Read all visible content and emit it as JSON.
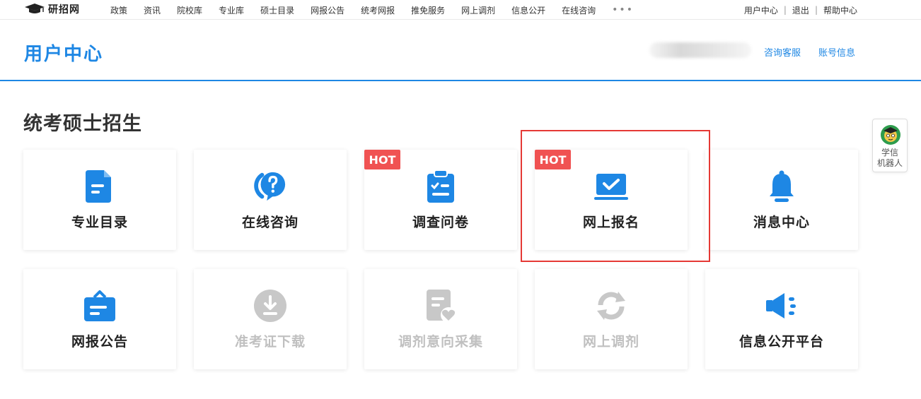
{
  "logo": {
    "text": "研招网"
  },
  "nav": {
    "items": [
      "政策",
      "资讯",
      "院校库",
      "专业库",
      "硕士目录",
      "网报公告",
      "统考网报",
      "推免服务",
      "网上调剂",
      "信息公开",
      "在线咨询"
    ],
    "more": "•••"
  },
  "toplinks": {
    "user_center": "用户中心",
    "logout": "退出",
    "help": "帮助中心",
    "sep": "|"
  },
  "header": {
    "title": "用户中心",
    "consult": "咨询客服",
    "account": "账号信息"
  },
  "section": {
    "title": "统考硕士招生"
  },
  "cards": [
    {
      "label": "专业目录",
      "icon": "document-icon",
      "hot": "",
      "enabled": true
    },
    {
      "label": "在线咨询",
      "icon": "chat-question-icon",
      "hot": "",
      "enabled": true
    },
    {
      "label": "调查问卷",
      "icon": "clipboard-check-icon",
      "hot": "HOT",
      "enabled": true
    },
    {
      "label": "网上报名",
      "icon": "laptop-check-icon",
      "hot": "HOT",
      "enabled": true
    },
    {
      "label": "消息中心",
      "icon": "bell-icon",
      "hot": "",
      "enabled": true
    },
    {
      "label": "网报公告",
      "icon": "briefcase-icon",
      "hot": "",
      "enabled": true
    },
    {
      "label": "准考证下载",
      "icon": "download-icon",
      "hot": "",
      "enabled": false
    },
    {
      "label": "调剂意向采集",
      "icon": "form-heart-icon",
      "hot": "",
      "enabled": false
    },
    {
      "label": "网上调剂",
      "icon": "refresh-icon",
      "hot": "",
      "enabled": false
    },
    {
      "label": "信息公开平台",
      "icon": "megaphone-icon",
      "hot": "",
      "enabled": true
    }
  ],
  "robot": {
    "line1": "学信",
    "line2": "机器人"
  },
  "colors": {
    "primary": "#1e87e4",
    "hot": "#f05252",
    "disabled": "#c8c8c8",
    "highlight": "#e53935"
  }
}
